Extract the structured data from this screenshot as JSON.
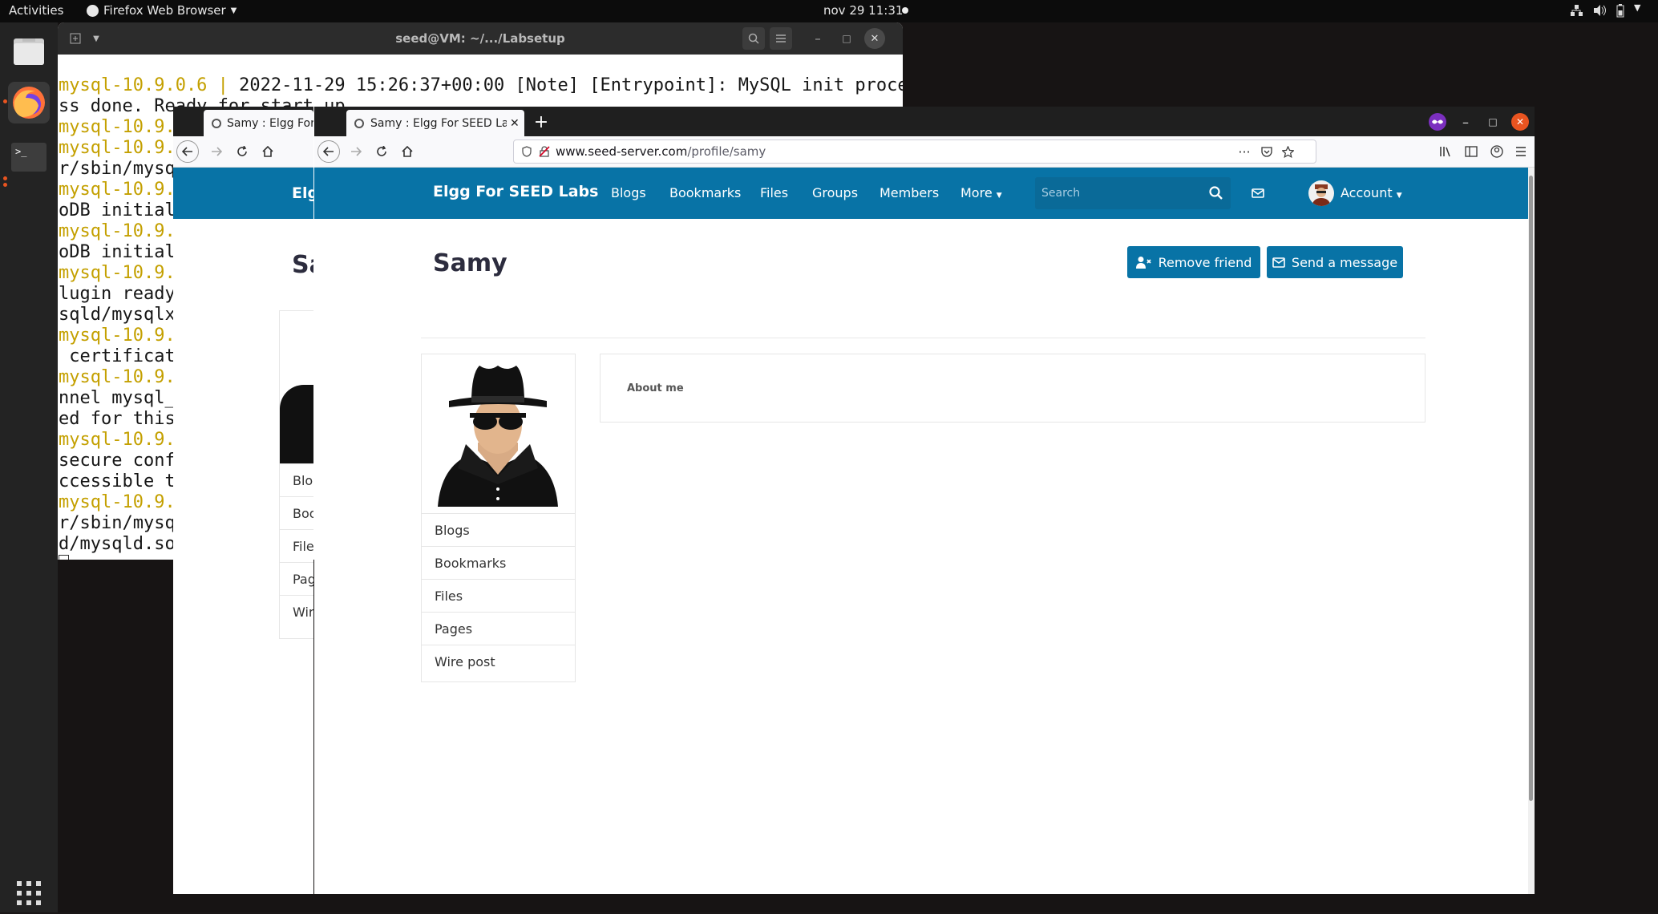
{
  "topbar": {
    "activities": "Activities",
    "app_name": "Firefox Web Browser",
    "clock": "nov 29  11:31"
  },
  "dock": {
    "items": [
      "files-icon",
      "firefox-icon",
      "terminal-icon",
      "apps-grid-icon"
    ]
  },
  "terminal": {
    "title": "seed@VM: ~/.../Labsetup",
    "line1_prefix": "mysql-10.9.0.6 |",
    "line1_text": " 2022-11-29 15:26:37+00:00 [Note] [Entrypoint]: MySQL init proce",
    "line2_text": "ss done. Ready for start up.",
    "partial_lines": [
      "mysql-10.9.0.6 |",
      "mysql-10.9.",
      "r/sbin/mysq",
      "mysql-10.9.",
      "oDB initial",
      "mysql-10.9.",
      "oDB initial",
      "mysql-10.9.",
      "lugin ready",
      "sqld/mysqlx",
      "mysql-10.9.",
      " certificat",
      "mysql-10.9.",
      "nnel mysql_",
      "ed for this",
      "mysql-10.9.",
      "secure conf",
      "ccessible t",
      "mysql-10.9.",
      "r/sbin/mysq",
      "d/mysqld.so"
    ]
  },
  "back_window": {
    "tab_title": "Samy : Elgg For S",
    "brand": "Elg",
    "title": "Sa",
    "menu": [
      "Blog",
      "Boo",
      "File",
      "Pag",
      "Wire"
    ]
  },
  "browser": {
    "tab_title": "Samy : Elgg For SEED Lab",
    "url_domain": "www.seed-server.com",
    "url_path": "/profile/samy"
  },
  "site": {
    "brand": "Elgg For SEED Labs",
    "nav": [
      "Blogs",
      "Bookmarks",
      "Files",
      "Groups",
      "Members",
      "More"
    ],
    "search_placeholder": "Search",
    "account": "Account",
    "profile_name": "Samy",
    "remove_friend": "Remove friend",
    "send_message": "Send a message",
    "owner_menu": [
      "Blogs",
      "Bookmarks",
      "Files",
      "Pages",
      "Wire post"
    ],
    "about_label": "About me"
  },
  "colors": {
    "elgg_blue": "#0873a6",
    "terminal_prefix": "#c4a000",
    "close_red": "#e95420"
  }
}
